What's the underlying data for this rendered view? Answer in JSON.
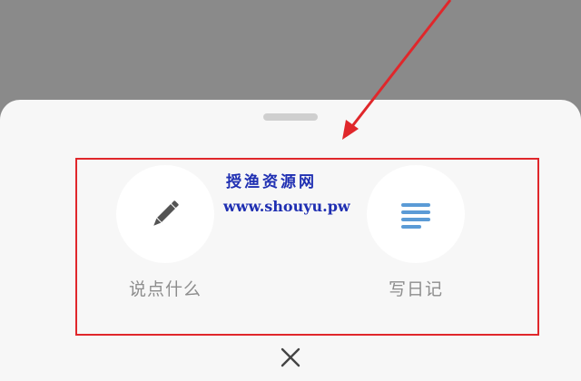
{
  "sheet": {
    "actions": [
      {
        "label": "说点什么",
        "icon": "pencil-icon"
      },
      {
        "label": "写日记",
        "icon": "text-lines-icon"
      }
    ],
    "close_icon": "close-icon"
  },
  "watermark": {
    "title": "授渔资源网",
    "url": "www.shouyu.pw"
  },
  "colors": {
    "overlay": "#8a8a8a",
    "sheet": "#f7f7f7",
    "annotation_red": "#e0272b",
    "pencil": "#545454",
    "lines": "#5b9bd6",
    "label": "#8d8d8d",
    "watermark": "#1f2fb2"
  }
}
